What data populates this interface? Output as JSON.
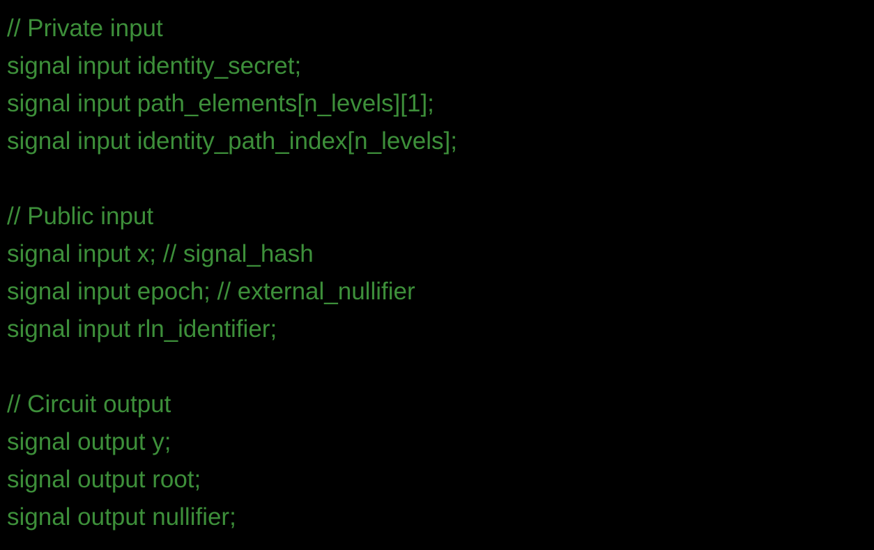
{
  "colors": {
    "background": "#000000",
    "text": "#3d8f3a"
  },
  "code": {
    "lines": [
      "// Private input",
      "signal input identity_secret;",
      "signal input path_elements[n_levels][1];",
      "signal input identity_path_index[n_levels];",
      "",
      "// Public input",
      "signal input x; // signal_hash",
      "signal input epoch; // external_nullifier",
      "signal input rln_identifier;",
      "",
      "// Circuit output",
      "signal output y;",
      "signal output root;",
      "signal output nullifier;"
    ]
  }
}
